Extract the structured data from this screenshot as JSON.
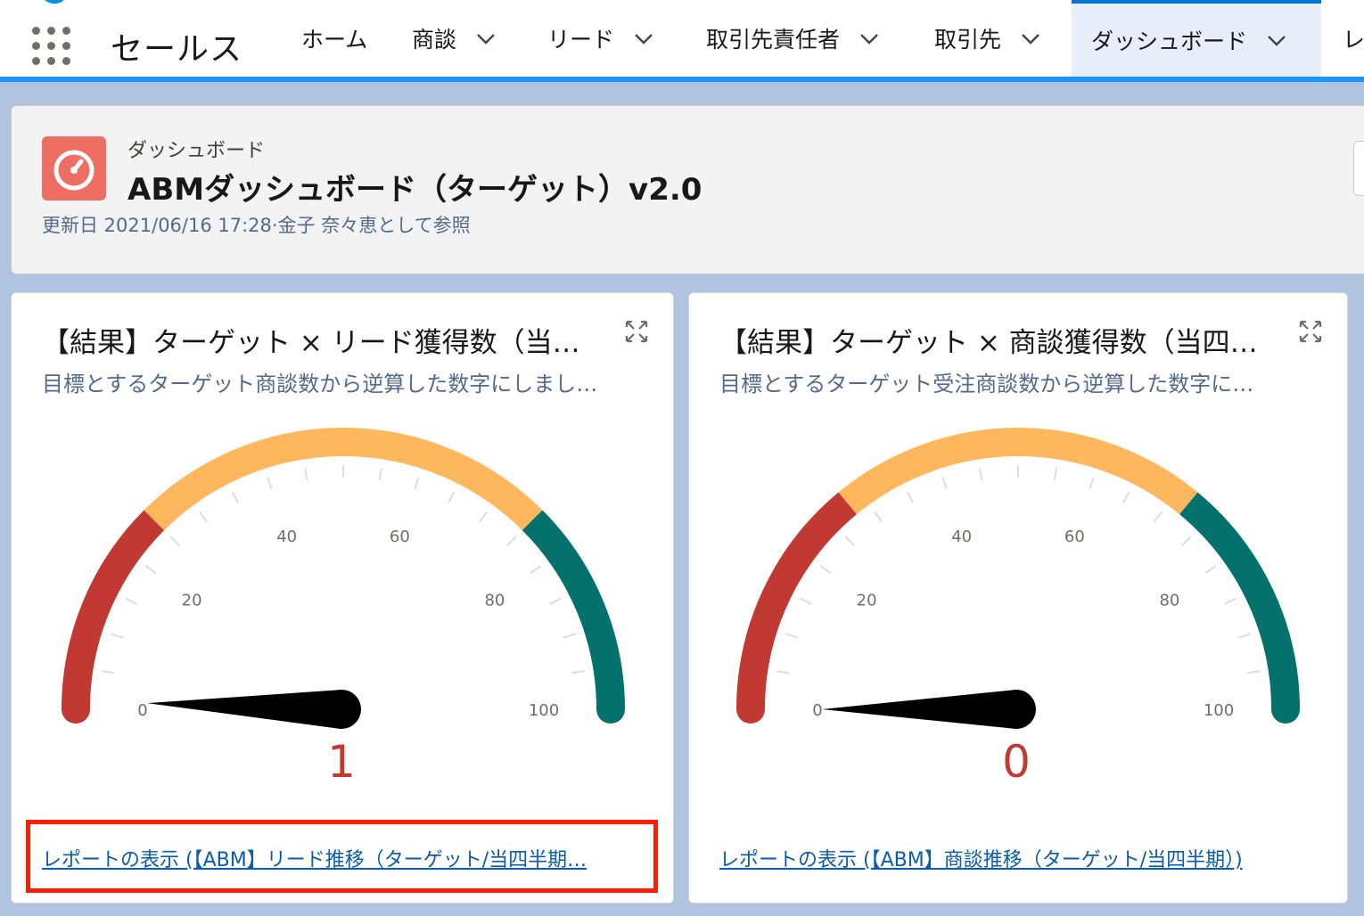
{
  "app": {
    "name": "セールス"
  },
  "nav": {
    "items": [
      {
        "label": "ホーム",
        "has_menu": false
      },
      {
        "label": "商談",
        "has_menu": true
      },
      {
        "label": "リード",
        "has_menu": true
      },
      {
        "label": "取引先責任者",
        "has_menu": true
      },
      {
        "label": "取引先",
        "has_menu": true
      },
      {
        "label": "ダッシュボード",
        "has_menu": true,
        "active": true
      },
      {
        "label": "レ",
        "has_menu": false
      }
    ]
  },
  "header": {
    "eyebrow": "ダッシュボード",
    "title": "ABMダッシュボード（ターゲット）v2.0",
    "meta": "更新日 2021/06/16 17:28·金子 奈々恵として参照",
    "icon": "gauge-icon"
  },
  "widgets": [
    {
      "title": "【結果】ターゲット × リード獲得数（当…",
      "subtitle": "目標とするターゲット商談数から逆算した数字にしまし…",
      "value_label": "1",
      "link": "レポートの表示 (【ABM】リード推移（ターゲット/当四半期…"
    },
    {
      "title": "【結果】ターゲット × 商談獲得数（当四…",
      "subtitle": "目標とするターゲット受注商談数から逆算した数字に…",
      "value_label": "0",
      "link": "レポートの表示 (【ABM】商談推移（ターゲット/当四半期）)"
    }
  ],
  "chart_data": [
    {
      "type": "gauge",
      "value": 1,
      "min": 0,
      "max": 100,
      "tick_labels": [
        "0",
        "20",
        "40",
        "60",
        "80",
        "100"
      ],
      "bands": [
        {
          "from": 0,
          "to": 25,
          "color": "#c23934"
        },
        {
          "from": 25,
          "to": 75,
          "color": "#ffb75d"
        },
        {
          "from": 75,
          "to": 100,
          "color": "#04716c"
        }
      ]
    },
    {
      "type": "gauge",
      "value": 0,
      "min": 0,
      "max": 100,
      "tick_labels": [
        "0",
        "20",
        "40",
        "60",
        "80",
        "100"
      ],
      "bands": [
        {
          "from": 0,
          "to": 28,
          "color": "#c23934"
        },
        {
          "from": 28,
          "to": 72,
          "color": "#ffb75d"
        },
        {
          "from": 72,
          "to": 100,
          "color": "#04716c"
        }
      ]
    }
  ],
  "colors": {
    "accent": "#0176d3",
    "value": "#c23934",
    "link": "#0b5cab",
    "highlight": "#ff1f00"
  }
}
